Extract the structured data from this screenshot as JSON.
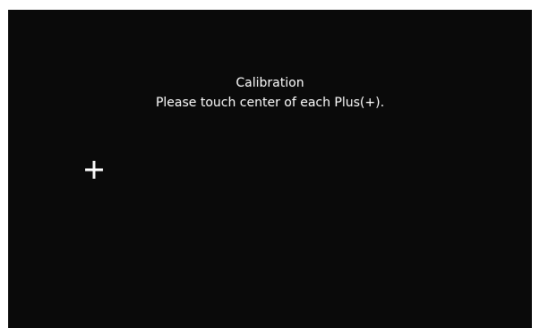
{
  "calibration": {
    "title": "Calibration",
    "instruction": "Please touch center of each Plus(+).",
    "target_icon": "plus-icon",
    "colors": {
      "background": "#0a0a0a",
      "text": "#ffffff",
      "crosshair": "#ffffff"
    }
  }
}
